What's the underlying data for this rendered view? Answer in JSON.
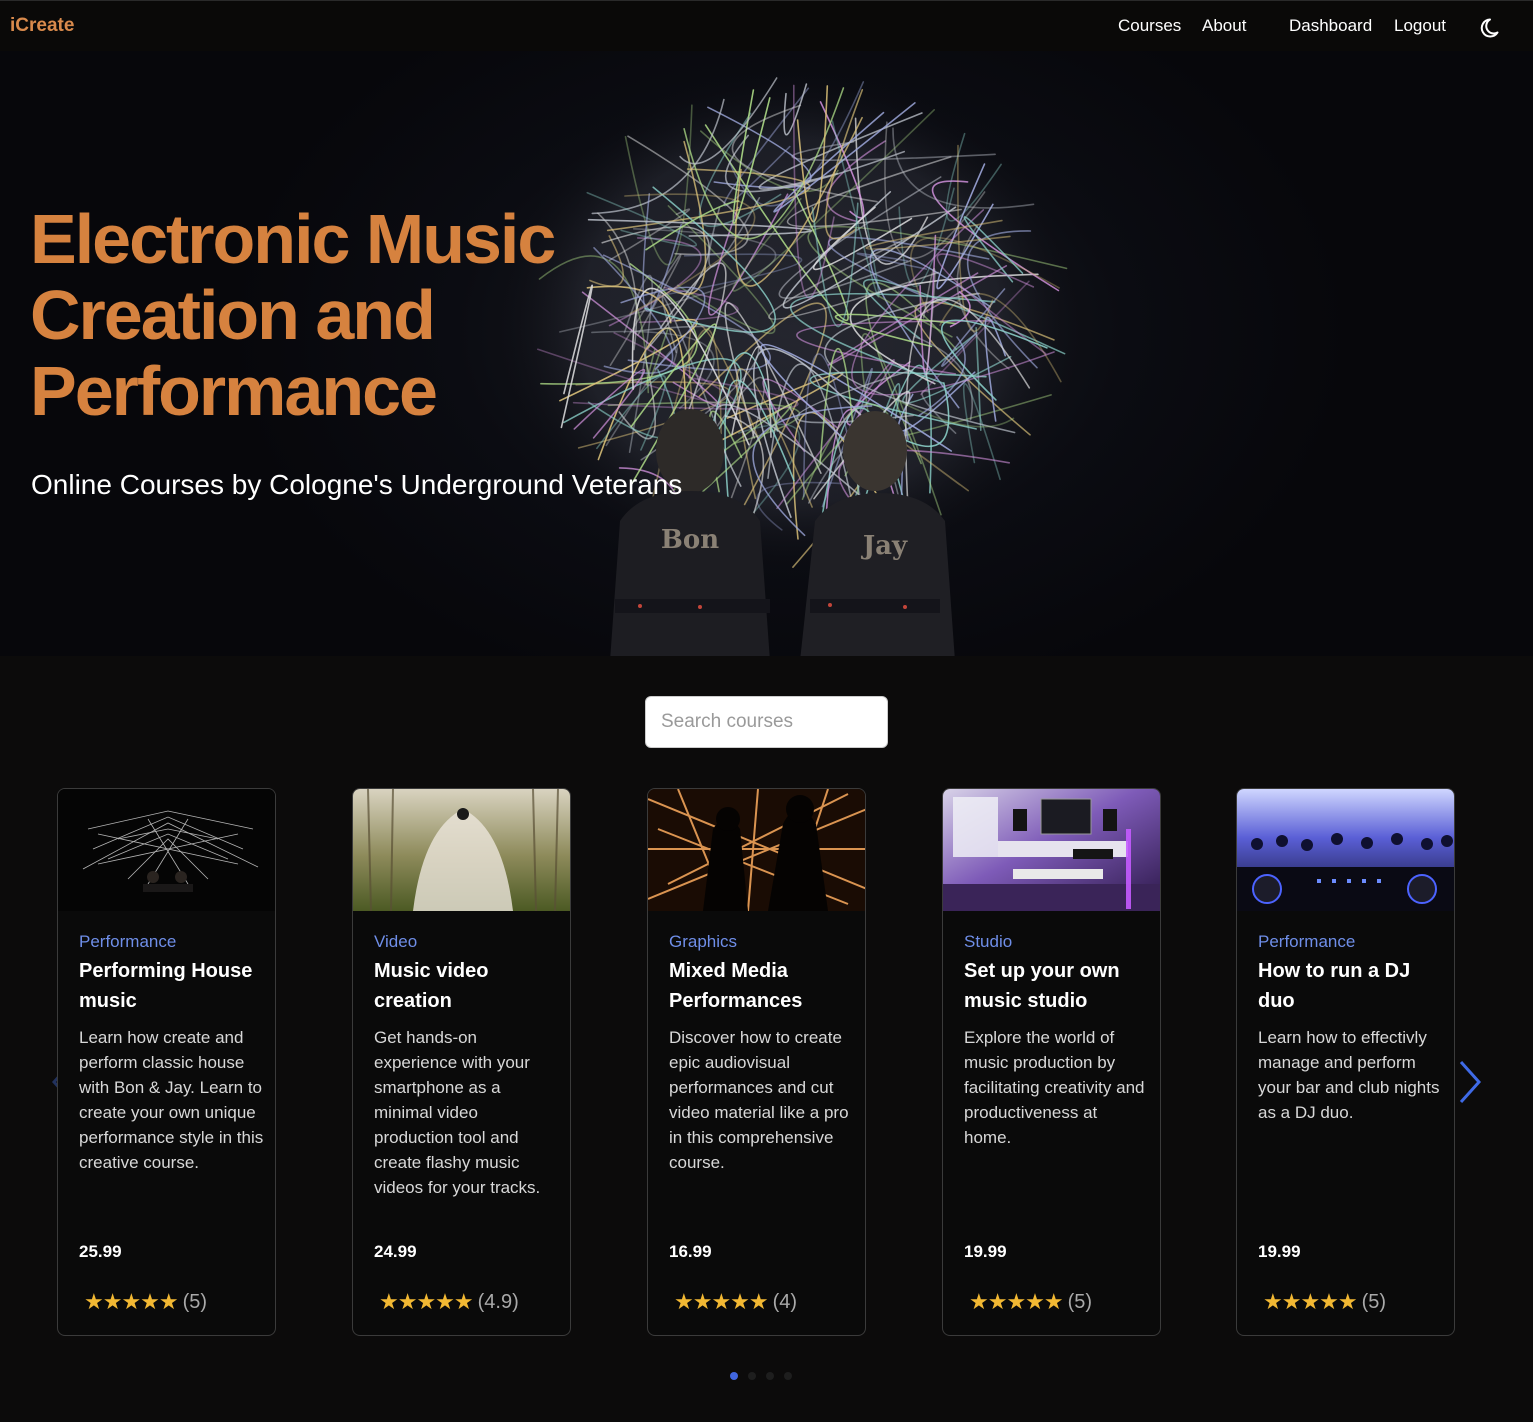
{
  "nav": {
    "brand": "iCreate",
    "links": [
      "Courses",
      "About",
      "Dashboard",
      "Logout"
    ]
  },
  "hero": {
    "title": "Electronic Music Creation and Performance",
    "subtitle": "Online Courses by Cologne's Underground Veterans",
    "shirt_left": "Bon",
    "shirt_right": "Jay"
  },
  "search": {
    "placeholder": "Search courses"
  },
  "colors": {
    "accent": "#d6823f",
    "category": "#6f8ee8",
    "stars": "#f2b833",
    "dot_active": "#4066e0"
  },
  "icons": {
    "theme_toggle": "moon-icon",
    "prev": "chevron-left-icon",
    "next": "chevron-right-icon",
    "star": "star-icon"
  },
  "courses": [
    {
      "category": "Performance",
      "title": "Performing House music",
      "description": "Learn how create and perform classic house with Bon & Jay. Learn to create your own unique performance style in this creative course.",
      "price": "25.99",
      "stars": "★★★★★",
      "rating": "(5)"
    },
    {
      "category": "Video",
      "title": "Music video creation",
      "description": "Get hands-on experience with your smartphone as a minimal video production tool and create flashy music videos for your tracks.",
      "price": "24.99",
      "stars": "★★★★★",
      "rating": "(4.9)"
    },
    {
      "category": "Graphics",
      "title": "Mixed Media Performances",
      "description": "Discover how to create epic audiovisual performances and cut video material like a pro in this comprehensive course.",
      "price": "16.99",
      "stars": "★★★★★",
      "rating": "(4)"
    },
    {
      "category": "Studio",
      "title": "Set up your own music studio",
      "description": "Explore the world of music production by facilitating creativity and productiveness at home.",
      "price": "19.99",
      "stars": "★★★★★",
      "rating": "(5)"
    },
    {
      "category": "Performance",
      "title": "How to run a DJ duo",
      "description": "Learn how to effectivly manage and perform your bar and club nights as a DJ duo.",
      "price": "19.99",
      "stars": "★★★★★",
      "rating": "(5)"
    }
  ],
  "carousel": {
    "active_page": 1,
    "page_count": 4
  }
}
